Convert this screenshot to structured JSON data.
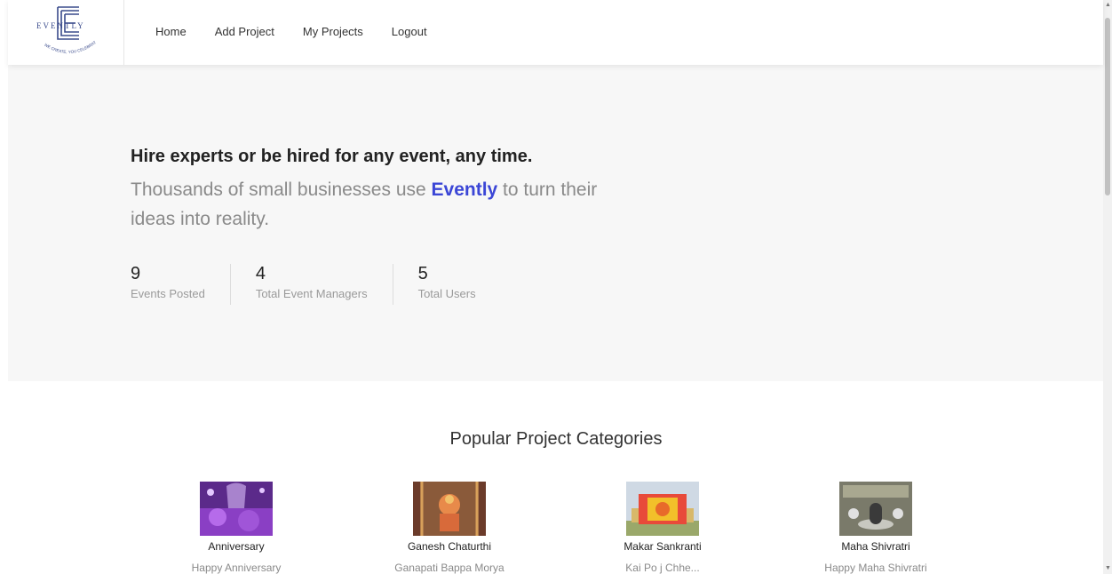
{
  "nav": {
    "logo_text": "EVENTLY",
    "logo_tagline": "WE CREATE, YOU CELEBRATE",
    "links": [
      "Home",
      "Add Project",
      "My Projects",
      "Logout"
    ]
  },
  "hero": {
    "heading": "Hire experts or be hired for any event, any time.",
    "sub_before": "Thousands of small businesses use ",
    "brand": "Evently",
    "sub_after": " to turn their ideas into reality.",
    "brand_color": "#3b46d6"
  },
  "stats": [
    {
      "value": "9",
      "label": "Events Posted"
    },
    {
      "value": "4",
      "label": "Total Event Managers"
    },
    {
      "value": "5",
      "label": "Total Users"
    }
  ],
  "categories_section": {
    "title": "Popular Project Categories",
    "items": [
      {
        "name": "Anniversary",
        "desc": "Happy Anniversary"
      },
      {
        "name": "Ganesh Chaturthi",
        "desc": "Ganapati Bappa Morya"
      },
      {
        "name": "Makar Sankranti",
        "desc": "Kai Po j Chhe..."
      },
      {
        "name": "Maha Shivratri",
        "desc": "Happy Maha Shivratri"
      }
    ]
  }
}
